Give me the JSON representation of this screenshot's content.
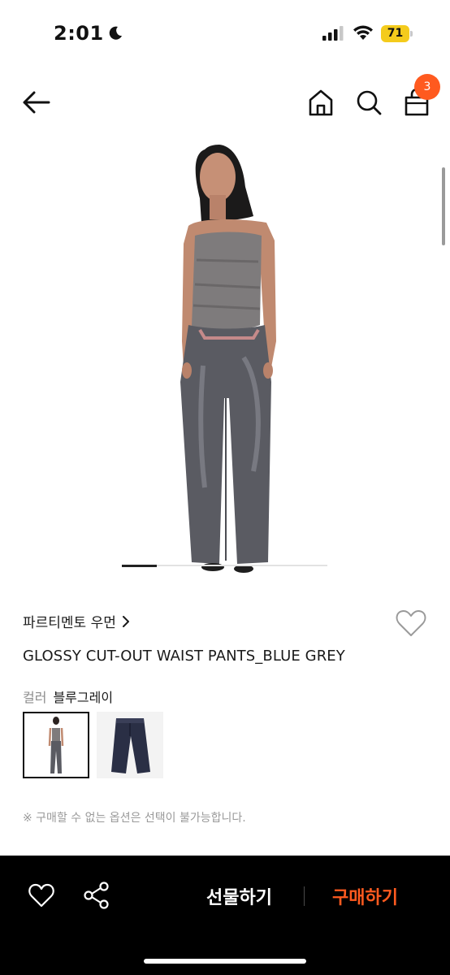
{
  "status_bar": {
    "time": "2:01",
    "battery_level": "71",
    "icons": [
      "moon-icon",
      "signal-icon",
      "wifi-icon",
      "battery-icon"
    ],
    "battery_color": "#f4cb1c"
  },
  "header": {
    "icons": [
      "back-arrow-icon",
      "home-icon",
      "search-icon",
      "shopping-bag-icon"
    ],
    "cart_count": "3",
    "badge_color": "#ff5a1f"
  },
  "gallery": {
    "slide_position": 0.17
  },
  "product": {
    "brand": "파르티멘토 우먼",
    "title": "GLOSSY CUT-OUT WAIST PANTS_BLUE GREY",
    "color_label": "컬러",
    "color_value": "블루그레이",
    "swatches": [
      "model-wearing-pants",
      "pants-flat-lay"
    ],
    "notice": "※ 구매할 수 없는 옵션은 선택이 불가능합니다."
  },
  "bottom_bar": {
    "icons": [
      "heart-icon",
      "share-icon"
    ],
    "gift_label": "선물하기",
    "buy_label": "구매하기",
    "accent_color": "#ff5a1f"
  }
}
